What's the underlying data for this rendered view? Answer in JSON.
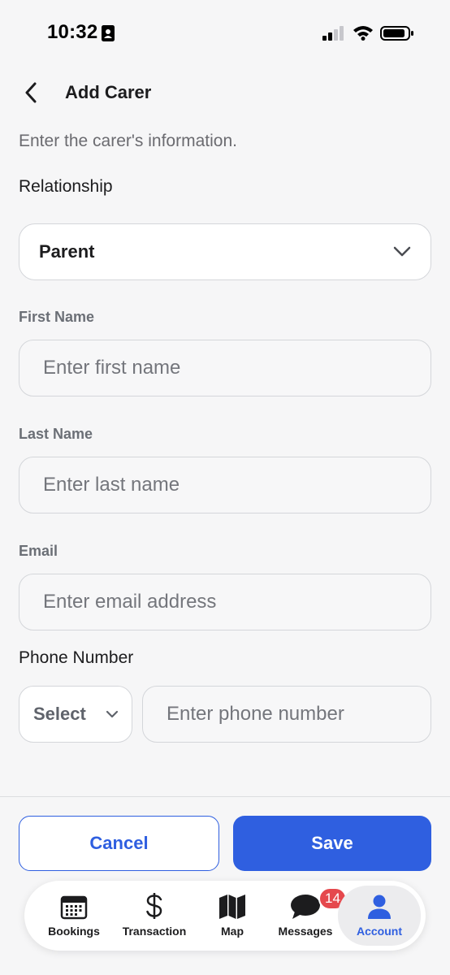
{
  "status_bar": {
    "time": "10:32"
  },
  "header": {
    "title": "Add Carer"
  },
  "intro": "Enter the carer's information.",
  "relationship": {
    "label": "Relationship",
    "value": "Parent"
  },
  "first_name": {
    "label": "First Name",
    "placeholder": "Enter first name",
    "value": ""
  },
  "last_name": {
    "label": "Last Name",
    "placeholder": "Enter last name",
    "value": ""
  },
  "email": {
    "label": "Email",
    "placeholder": "Enter email address",
    "value": ""
  },
  "phone": {
    "label": "Phone Number",
    "code_label": "Select",
    "placeholder": "Enter phone number",
    "value": ""
  },
  "actions": {
    "cancel_label": "Cancel",
    "save_label": "Save"
  },
  "tabs": [
    {
      "label": "Bookings",
      "icon": "calendar-icon"
    },
    {
      "label": "Transaction",
      "icon": "dollar-icon"
    },
    {
      "label": "Map",
      "icon": "map-icon"
    },
    {
      "label": "Messages",
      "icon": "chat-bubble-icon",
      "badge": "14"
    },
    {
      "label": "Account",
      "icon": "person-icon",
      "active": true
    }
  ],
  "colors": {
    "accent": "#2f5fe0",
    "badge": "#e5484d",
    "background": "#f6f6f7"
  }
}
